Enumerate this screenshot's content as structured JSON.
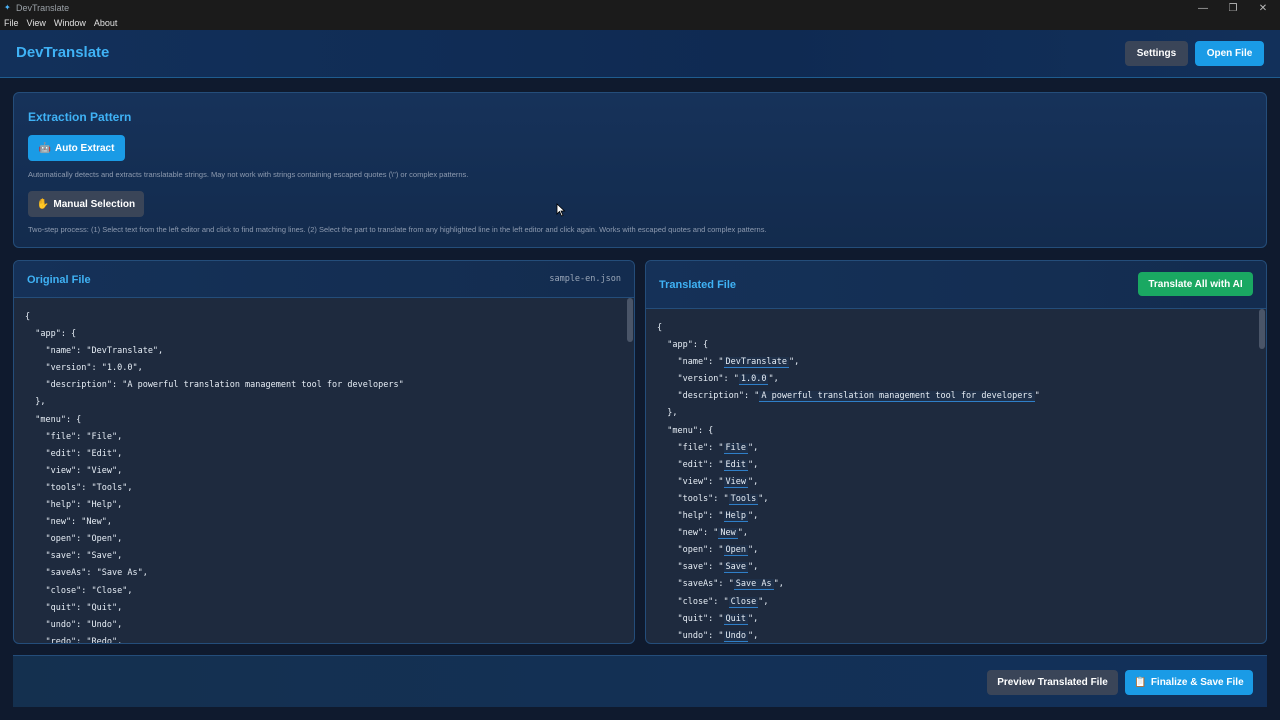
{
  "window": {
    "title": "DevTranslate",
    "menu": [
      "File",
      "View",
      "Window",
      "About"
    ],
    "controls": {
      "minimize": "—",
      "restore": "❐",
      "close": "✕"
    }
  },
  "header": {
    "brand": "DevTranslate",
    "settings_label": "Settings",
    "open_file_label": "Open File"
  },
  "extraction": {
    "title": "Extraction Pattern",
    "auto_label": "Auto Extract",
    "auto_icon": "robot-icon",
    "auto_desc": "Automatically detects and extracts translatable strings. May not work with strings containing escaped quotes (\\\") or complex patterns.",
    "manual_label": "Manual Selection",
    "manual_icon": "hand-icon",
    "manual_desc": "Two-step process: (1) Select text from the left editor and click to find matching lines. (2) Select the part to translate from any highlighted line in the left editor and click again. Works with escaped quotes and complex patterns."
  },
  "original": {
    "title": "Original File",
    "filename": "sample-en.json",
    "lines": [
      "{",
      "  \"app\": {",
      "    \"name\": \"DevTranslate\",",
      "    \"version\": \"1.0.0\",",
      "    \"description\": \"A powerful translation management tool for developers\"",
      "  },",
      "  \"menu\": {",
      "    \"file\": \"File\",",
      "    \"edit\": \"Edit\",",
      "    \"view\": \"View\",",
      "    \"tools\": \"Tools\",",
      "    \"help\": \"Help\",",
      "    \"new\": \"New\",",
      "    \"open\": \"Open\",",
      "    \"save\": \"Save\",",
      "    \"saveAs\": \"Save As\",",
      "    \"close\": \"Close\",",
      "    \"quit\": \"Quit\",",
      "    \"undo\": \"Undo\",",
      "    \"redo\": \"Redo\","
    ]
  },
  "translated": {
    "title": "Translated File",
    "ai_label": "Translate All with AI",
    "lines": [
      {
        "pre": "{",
        "val": "",
        "post": ""
      },
      {
        "pre": "  \"app\": {",
        "val": "",
        "post": ""
      },
      {
        "pre": "    \"name\": \"",
        "val": "DevTranslate",
        "post": "\","
      },
      {
        "pre": "    \"version\": \"",
        "val": "1.0.0",
        "post": "\","
      },
      {
        "pre": "    \"description\": \"",
        "val": "A powerful translation management tool for developers",
        "post": "\""
      },
      {
        "pre": "  },",
        "val": "",
        "post": ""
      },
      {
        "pre": "  \"menu\": {",
        "val": "",
        "post": ""
      },
      {
        "pre": "    \"file\": \"",
        "val": "File",
        "post": "\","
      },
      {
        "pre": "    \"edit\": \"",
        "val": "Edit",
        "post": "\","
      },
      {
        "pre": "    \"view\": \"",
        "val": "View",
        "post": "\","
      },
      {
        "pre": "    \"tools\": \"",
        "val": "Tools",
        "post": "\","
      },
      {
        "pre": "    \"help\": \"",
        "val": "Help",
        "post": "\","
      },
      {
        "pre": "    \"new\": \"",
        "val": "New",
        "post": "\","
      },
      {
        "pre": "    \"open\": \"",
        "val": "Open",
        "post": "\","
      },
      {
        "pre": "    \"save\": \"",
        "val": "Save",
        "post": "\","
      },
      {
        "pre": "    \"saveAs\": \"",
        "val": "Save As",
        "post": "\","
      },
      {
        "pre": "    \"close\": \"",
        "val": "Close",
        "post": "\","
      },
      {
        "pre": "    \"quit\": \"",
        "val": "Quit",
        "post": "\","
      },
      {
        "pre": "    \"undo\": \"",
        "val": "Undo",
        "post": "\","
      }
    ]
  },
  "footer": {
    "preview_label": "Preview Translated File",
    "finalize_label": "Finalize & Save File",
    "finalize_icon": "clipboard-icon"
  }
}
